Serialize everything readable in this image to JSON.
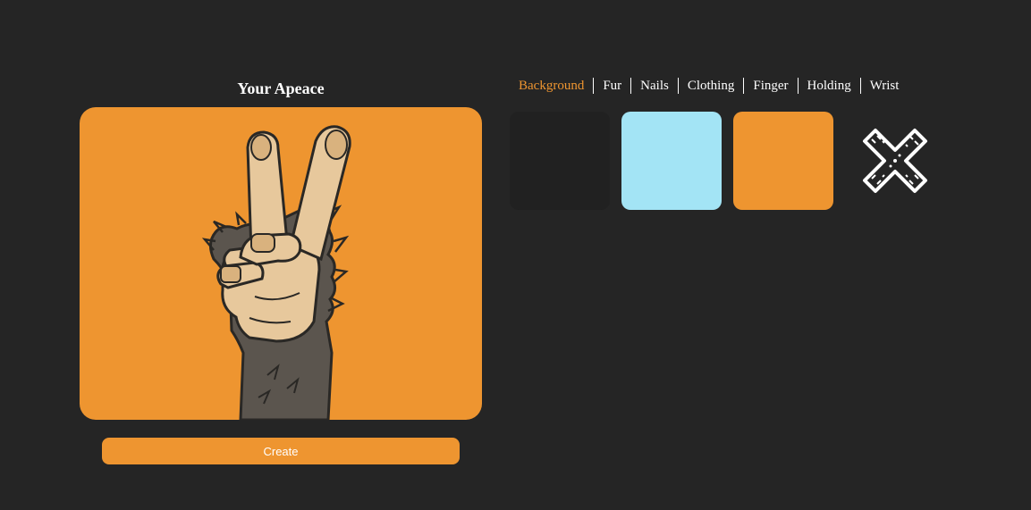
{
  "preview": {
    "title": "Your Apeace",
    "background_color": "#ee9530",
    "image_icon": "peace-sign-hand-icon"
  },
  "create_button": {
    "label": "Create",
    "color": "#ee9530"
  },
  "tabs": [
    {
      "label": "Background",
      "active": true
    },
    {
      "label": "Fur",
      "active": false
    },
    {
      "label": "Nails",
      "active": false
    },
    {
      "label": "Clothing",
      "active": false
    },
    {
      "label": "Finger",
      "active": false
    },
    {
      "label": "Holding",
      "active": false
    },
    {
      "label": "Wrist",
      "active": false
    }
  ],
  "colors": {
    "page_background": "#252525",
    "active_tab": "#ee9530",
    "inactive_tab": "#ffffff"
  },
  "swatches": [
    {
      "color": "#212121"
    },
    {
      "color": "#a3e4f5"
    },
    {
      "color": "#ee9530"
    },
    {
      "icon": "remove-x-icon"
    }
  ]
}
